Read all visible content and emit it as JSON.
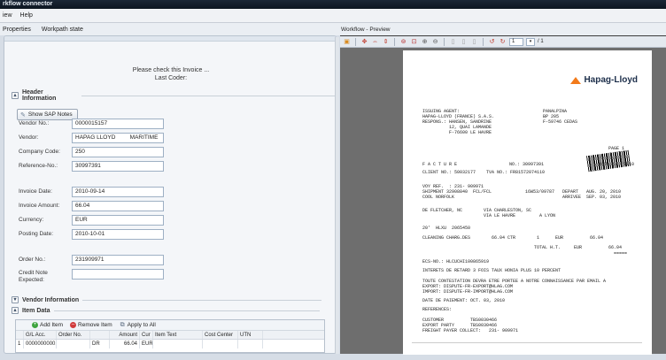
{
  "window": {
    "title": "rkflow connector"
  },
  "menu": {
    "items": [
      "iew",
      "Help"
    ]
  },
  "tabs": {
    "left": [
      "Properties",
      "Workpath state"
    ],
    "right": "Workflow - Preview"
  },
  "notice": {
    "line1": "Please check this Invoice ...",
    "line2": "Last Coder:"
  },
  "header_section": {
    "title": "Header Information",
    "sap_button": "Show SAP Notes"
  },
  "fields": [
    {
      "label": "Vendor No.:",
      "value": "0000015157"
    },
    {
      "label": "Vendor:",
      "value": "HAPAG LLOYD         MARITIME"
    },
    {
      "label": "Company Code:",
      "value": "250"
    },
    {
      "label": "Reference-No.:",
      "value": "30997391"
    },
    {
      "label": "Invoice Date:",
      "value": "2010-09-14"
    },
    {
      "label": "Invoice Amount:",
      "value": "66.04"
    },
    {
      "label": "Currency:",
      "value": "EUR"
    },
    {
      "label": "Posting Date:",
      "value": "2010-10-01"
    },
    {
      "label": "Order No.:",
      "value": "231909971"
    },
    {
      "label": "Credit Note",
      "label2": "Expected:",
      "value": ""
    }
  ],
  "vendor_section": {
    "title": "Vendor Information"
  },
  "item_section": {
    "title": "Item Data"
  },
  "item_grid": {
    "add": "Add Item",
    "remove": "Remove Item",
    "apply": "Apply to All",
    "columns": [
      "G/L Acc.",
      "Order No.",
      "",
      "Amount",
      "Cur",
      "Item Text",
      "Cost Center",
      "UTN"
    ],
    "rows": [
      {
        "idx": "1",
        "gl": "0000000000...",
        "order": "",
        "dc": "DR",
        "amount": "66.04",
        "cur": "EUR",
        "text": "",
        "cc": "",
        "utn": ""
      }
    ]
  },
  "viewer": {
    "page": "1",
    "of": "/ 1"
  },
  "document": {
    "logo": "Hapag-Lloyd",
    "agent": "ISSUING AGENT:\nHAPAG-LLOYD (FRANCE) S.A.S.\nRESPONS.: HANSEN, SANDRINE\n          12, QUAI LAMANDE\n          F-76600 LE HAVRE",
    "addressee": "PANALPINA\nBP 205\nF-59746 CEDAS",
    "page_mark": "PAGE 1",
    "facture": "F A C T U R E",
    "no": "NO.: 30997391",
    "date": "SEP. 14, 2010",
    "client": "CLIENT NO.: 50032177    TVA NO.: FR81572074110",
    "voy": "VOY REF.  : 231- 909971\nSHIPMENT 32908840  FCL/FCL\nCOOL NORFOLK",
    "voy_right": "16W53/09787   DEPART   AUG. 20, 2010\n              ARRIVEE  SEP. 03, 2010",
    "routing": "DE FLETCHER, NC        VIA CHARLESTON, SC\n                       VIA LE HAVRE         A LYON",
    "container": "20'  HLXU  2065450",
    "charge": "CLEANING CHARG.DES        66.04 CTR        1      EUR          66.04",
    "total": "TOTAL H.T.     EUR          66.04",
    "stars": "=====",
    "ecs": "ECS-NO.: HLCUCHI100865919",
    "interest": "INTERETS DE RETARD 3 FOIS TAUX HONIA PLUS 10 PERCENT",
    "dispute": "TOUTE CONTESTATION DEVRA ETRE PORTEE A NOTRE CONNAISSANCE PAR EMAIL A\nEXPORT: DISPUTE-FR-EXPORT@HLAG.COM\nIMPORT: DISPUTE-FR-IMPORT@HLAG.COM",
    "payment": "DATE DE PAIEMENT: OCT. 03, 2010",
    "refs": "REFERENCES:\n\nCUSTOMER          TBS0030466\nEXPORT PARTY      TBS0030466\nFREIGHT PAYER COLLECT:   231- 909971"
  }
}
